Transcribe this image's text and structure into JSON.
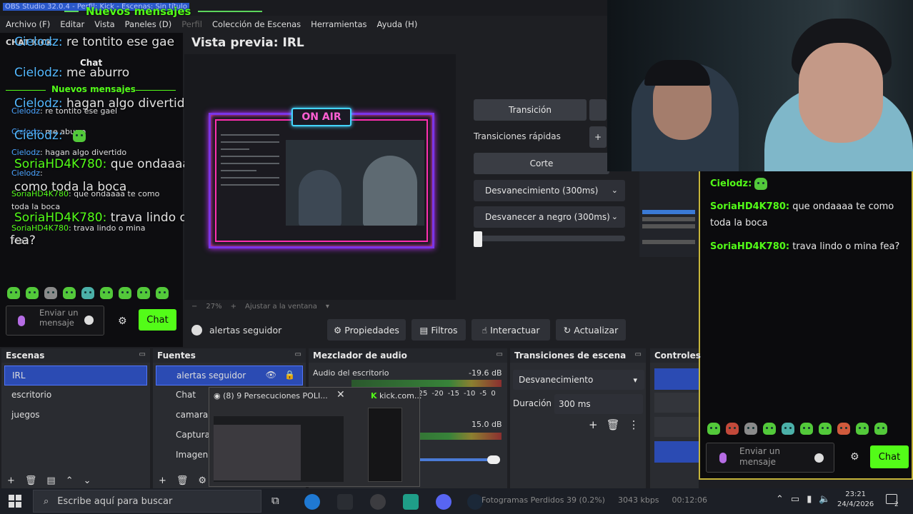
{
  "titlebar": {
    "title": "OBS Studio 32.0.4 - Perfil: Kick - Escenas: Sin título"
  },
  "overlay_banner": {
    "text": "Nuevos mensajes"
  },
  "menu": [
    "Archivo (F)",
    "Editar",
    "Vista",
    "Paneles (D)",
    "Perfil",
    "Colección de Escenas",
    "Herramientas",
    "Ayuda (H)"
  ],
  "chat_dock": {
    "title": "CHAT KICK",
    "chat_tab": "Chat",
    "big_messages": [
      {
        "user": "Cielodz:",
        "text": " re tontito ese gae"
      },
      {
        "user": "Cielodz:",
        "text": " me aburro"
      },
      {
        "user": "Cielodz:",
        "text": " hagan algo divertido"
      },
      {
        "user": "Cielodz:",
        "text": ""
      },
      {
        "user": "SoriaHD4K780:",
        "text": " que ondaaaa te"
      },
      {
        "user": "",
        "text": "como toda la boca"
      },
      {
        "user": "SoriaHD4K780:",
        "text": " trava lindo o mina"
      },
      {
        "user": "",
        "text": "fea?"
      }
    ],
    "new_messages": "Nuevos mensajes",
    "small_messages": [
      {
        "user": "Cielodz",
        "text": ": re tontito ese gael"
      },
      {
        "user": "Cielodz",
        "text": ": me aburro"
      },
      {
        "user": "Cielodz",
        "text": ": hagan algo divertido"
      },
      {
        "user": "Cielodz",
        "text": ":"
      },
      {
        "user": "SoriaHD4K780",
        "text": ": que ondaaaa te como"
      },
      {
        "user": "",
        "text": "toda la boca"
      },
      {
        "user": "SoriaHD4K780",
        "text": ": trava lindo o mina"
      },
      {
        "user": "",
        "text": "fea?"
      }
    ],
    "input_placeholder": "Enviar un mensaje",
    "send_label": "Chat"
  },
  "preview": {
    "label": "Vista previa: IRL",
    "on_air": "ON AIR",
    "zoom": "27%",
    "fit_label": "Ajustar a la ventana"
  },
  "transitions": {
    "transition_btn": "Transición",
    "quick_label": "Transiciones rápidas",
    "cut": "Corte",
    "fade": "Desvanecimiento (300ms)",
    "fade_black": "Desvanecer a negro (300ms)"
  },
  "right_chat": {
    "messages": [
      {
        "user": "Cielodz:",
        "text": ""
      },
      {
        "user": "SoriaHD4K780:",
        "text": " que ondaaaa te como toda la boca"
      },
      {
        "user": "SoriaHD4K780:",
        "text": " trava lindo o mina fea?"
      }
    ],
    "input_placeholder": "Enviar un mensaje",
    "send_label": "Chat"
  },
  "source_toolbar": {
    "source_name": "alertas seguidor",
    "properties": "Propiedades",
    "filters": "Filtros",
    "interact": "Interactuar",
    "refresh": "Actualizar"
  },
  "scenes": {
    "title": "Escenas",
    "items": [
      "IRL",
      "escritorio",
      "juegos"
    ]
  },
  "sources": {
    "title": "Fuentes",
    "items": [
      "alertas seguidor",
      "Chat",
      "camara",
      "Captura",
      "Imagen"
    ]
  },
  "mixer": {
    "title": "Mezclador de audio",
    "track1": "Audio del escritorio",
    "track1_db": "-19.6 dB",
    "track2_db": "15.0 dB",
    "scale": [
      "-25",
      "-20",
      "-15",
      "-10",
      "-5",
      "0"
    ]
  },
  "scene_transitions": {
    "title": "Transiciones de escena",
    "type": "Desvanecimiento",
    "duration_label": "Duración",
    "duration_value": "300 ms"
  },
  "controls": {
    "title": "Controles"
  },
  "taskbar_popup": {
    "title1": "(8) 9 Persecuciones POLI...",
    "title2": "kick.com..."
  },
  "taskbar": {
    "search_placeholder": "Escribe aquí para buscar",
    "status_dropped": "Fotogramas Perdidos 39 (0.2%)",
    "status_kbps": "3043 kbps",
    "status_time": "00:12:06",
    "clock_time": "23:21",
    "clock_date": "24/4/2026",
    "notif_count": "2"
  },
  "colors": {
    "kick_green": "#53fc18",
    "selection_blue": "#2b4bb3",
    "on_air_pink": "#ff5fd3",
    "frame_gold": "#c6b53a"
  }
}
